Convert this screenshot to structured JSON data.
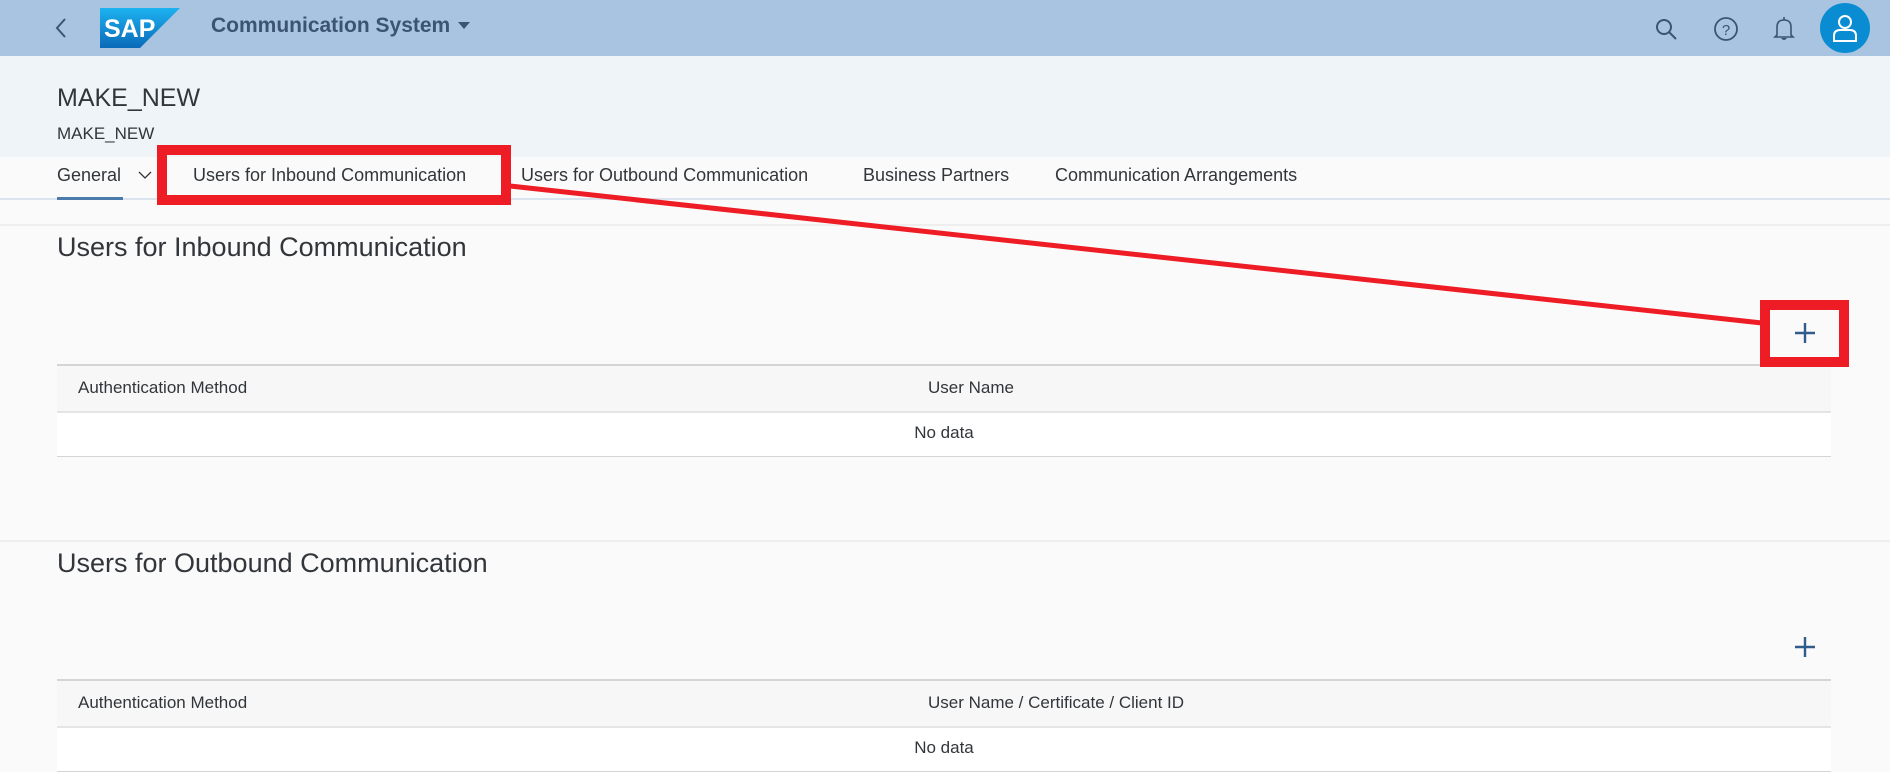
{
  "shell": {
    "app_title": "Communication System",
    "logo_text": "SAP",
    "icons": [
      "back-icon",
      "search-icon",
      "help-icon",
      "notifications-icon",
      "user-avatar-icon"
    ]
  },
  "header": {
    "title": "MAKE_NEW",
    "subtitle": "MAKE_NEW"
  },
  "tabs": [
    {
      "label": "General",
      "selected": true
    },
    {
      "label": "Users for Inbound Communication",
      "selected": false
    },
    {
      "label": "Users for Outbound Communication",
      "selected": false
    },
    {
      "label": "Business Partners",
      "selected": false
    },
    {
      "label": "Communication Arrangements",
      "selected": false
    }
  ],
  "sections": {
    "inbound": {
      "title": "Users for Inbound Communication",
      "add_label": "+",
      "columns": [
        "Authentication Method",
        "User Name"
      ],
      "empty_text": "No data"
    },
    "outbound": {
      "title": "Users for Outbound Communication",
      "add_label": "+",
      "columns": [
        "Authentication Method",
        "User Name / Certificate / Client ID"
      ],
      "empty_text": "No data"
    }
  },
  "annotation": {
    "color": "#ee1c25",
    "targets": [
      "tab-users-inbound",
      "inbound-add-button"
    ]
  }
}
